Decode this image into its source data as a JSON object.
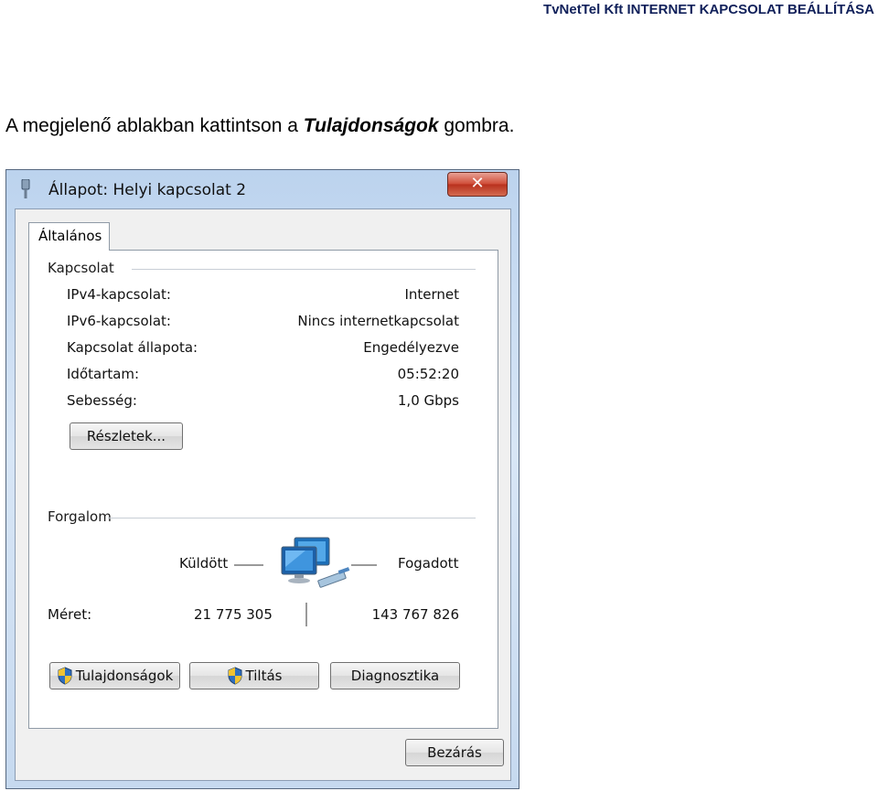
{
  "document": {
    "header": "TvNetTel Kft INTERNET KAPCSOLAT BEÁLLÍTÁSA",
    "instruction_prefix": "A megjelenő ablakban kattintson a ",
    "instruction_emphasis": "Tulajdonságok",
    "instruction_suffix": " gombra."
  },
  "window": {
    "title": "Állapot: Helyi kapcsolat 2",
    "close_label": "✕",
    "tab_label": "Általános",
    "connection": {
      "heading": "Kapcsolat",
      "rows": [
        {
          "label": "IPv4-kapcsolat:",
          "value": "Internet"
        },
        {
          "label": "IPv6-kapcsolat:",
          "value": "Nincs internetkapcsolat"
        },
        {
          "label": "Kapcsolat állapota:",
          "value": "Engedélyezve"
        },
        {
          "label": "Időtartam:",
          "value": "05:52:20"
        },
        {
          "label": "Sebesség:",
          "value": "1,0 Gbps"
        }
      ],
      "details_button": "Részletek..."
    },
    "traffic": {
      "heading": "Forgalom",
      "sent_label": "Küldött",
      "received_label": "Fogadott",
      "size_label": "Méret:",
      "sent_value": "21 775 305",
      "received_value": "143 767 826"
    },
    "buttons": {
      "properties": "Tulajdonságok",
      "disable": "Tiltás",
      "diagnose": "Diagnosztika",
      "close": "Bezárás"
    }
  }
}
